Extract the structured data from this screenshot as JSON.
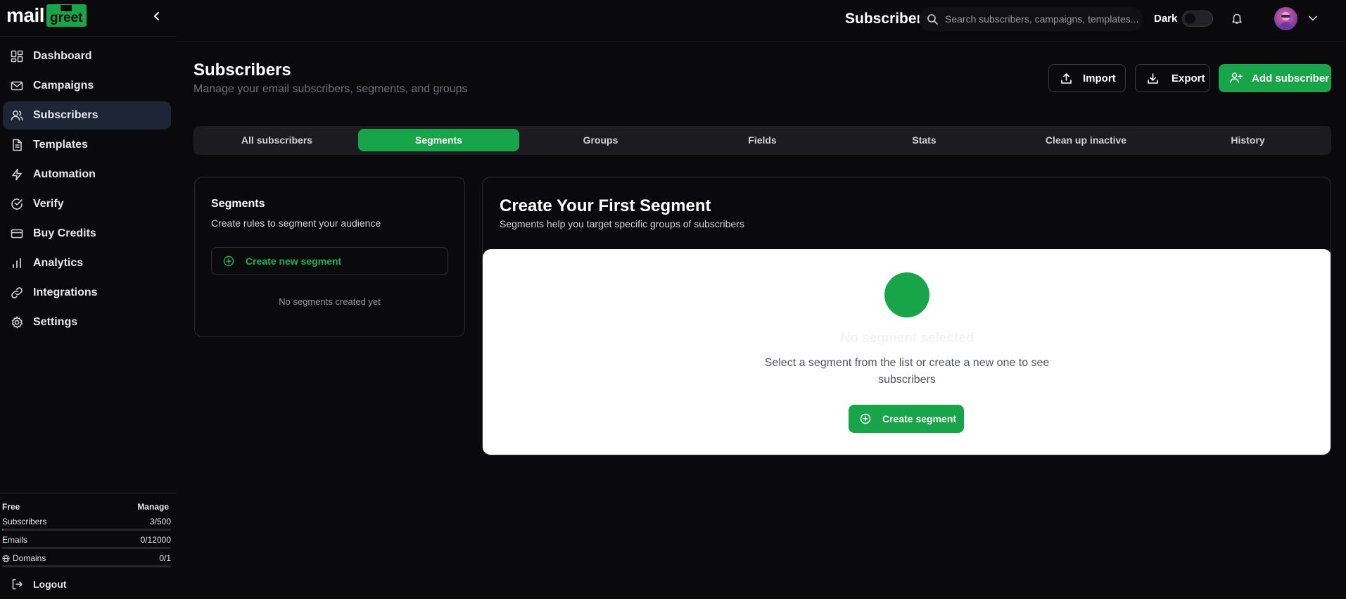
{
  "app": {
    "logo_main": "mail",
    "logo_accent": "greet"
  },
  "sidebar": {
    "items": [
      {
        "label": "Dashboard",
        "icon": "dashboard-icon"
      },
      {
        "label": "Campaigns",
        "icon": "mail-icon"
      },
      {
        "label": "Subscribers",
        "icon": "users-icon",
        "active": true
      },
      {
        "label": "Templates",
        "icon": "file-text-icon"
      },
      {
        "label": "Automation",
        "icon": "zap-icon"
      },
      {
        "label": "Verify",
        "icon": "check-circle-icon"
      },
      {
        "label": "Buy Credits",
        "icon": "credit-card-icon"
      },
      {
        "label": "Analytics",
        "icon": "bar-chart-icon"
      },
      {
        "label": "Integrations",
        "icon": "link-icon"
      },
      {
        "label": "Settings",
        "icon": "gear-icon"
      }
    ],
    "plan": {
      "name": "Free",
      "manage_label": "Manage",
      "subscribers_label": "Subscribers",
      "subscribers_value": "3/500",
      "subscribers_fraction": 0.006,
      "emails_label": "Emails",
      "emails_value": "0/12000",
      "emails_fraction": 0,
      "domains_label": "Domains",
      "domains_value": "0/1",
      "domains_fraction": 0
    },
    "logout_label": "Logout"
  },
  "header": {
    "title": "Subscribers",
    "search_placeholder": "Search subscribers, campaigns, templates...",
    "theme_label": "Dark"
  },
  "page": {
    "title": "Subscribers",
    "subtitle": "Manage your email subscribers, segments, and groups",
    "import_label": "Import",
    "export_label": "Export",
    "add_label": "Add subscriber"
  },
  "tabs": [
    {
      "label": "All subscribers"
    },
    {
      "label": "Segments",
      "active": true
    },
    {
      "label": "Groups"
    },
    {
      "label": "Fields"
    },
    {
      "label": "Stats"
    },
    {
      "label": "Clean up inactive"
    },
    {
      "label": "History"
    }
  ],
  "segments_panel": {
    "title": "Segments",
    "subtitle": "Create rules to segment your audience",
    "create_label": "Create new segment",
    "empty_text": "No segments created yet"
  },
  "main_panel": {
    "title": "Create Your First Segment",
    "subtitle": "Segments help you target specific groups of subscribers",
    "empty_title": "No segment selected",
    "empty_desc": "Select a segment from the list or create a new one to see subscribers",
    "create_label": "Create segment"
  },
  "colors": {
    "accent": "#18a54a",
    "active_nav": "#1d2536",
    "background": "#0a0a0c"
  }
}
